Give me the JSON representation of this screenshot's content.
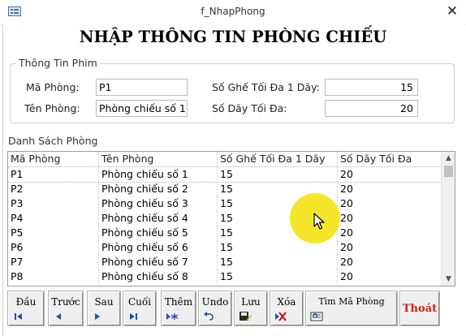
{
  "window": {
    "title": "f_NhapPhong"
  },
  "heading": "NHẬP THÔNG TIN PHÒNG CHIẾU",
  "info": {
    "caption": "Thông Tin Phim",
    "ma_phong_label": "Mã Phòng:",
    "ma_phong_value": "P1",
    "ten_phong_label": "Tên Phòng:",
    "ten_phong_value": "Phòng chiếu số 1",
    "so_ghe_label": "Số Ghế Tối Đa 1 Dãy:",
    "so_ghe_value": "15",
    "so_day_label": "Số Dãy Tối Đa:",
    "so_day_value": "20"
  },
  "list": {
    "caption": "Danh Sách Phòng",
    "headers": [
      "Mã Phòng",
      "Tên Phòng",
      "Số Ghế Tối Đa 1 Dãy",
      "Số Dãy Tối Đa"
    ],
    "rows": [
      [
        "P1",
        "Phòng chiếu số 1",
        "15",
        "20"
      ],
      [
        "P2",
        "Phòng chiếu số 2",
        "15",
        "20"
      ],
      [
        "P3",
        "Phòng chiếu số 3",
        "15",
        "20"
      ],
      [
        "P4",
        "Phòng chiếu số 4",
        "15",
        "20"
      ],
      [
        "P5",
        "Phòng chiếu số 5",
        "15",
        "20"
      ],
      [
        "P6",
        "Phòng chiếu số 6",
        "15",
        "20"
      ],
      [
        "P7",
        "Phòng chiếu số 7",
        "15",
        "20"
      ],
      [
        "P8",
        "Phòng chiếu số 8",
        "15",
        "20"
      ]
    ]
  },
  "buttons": {
    "first": "Đầu",
    "prev": "Trước",
    "next": "Sau",
    "last": "Cuối",
    "add": "Thêm",
    "undo": "Undo",
    "save": "Lưu",
    "delete": "Xóa",
    "find": "Tìm Mã Phòng",
    "exit": "Thoát"
  },
  "colors": {
    "exit_text": "#cc1f1f",
    "nav_icon": "#1f4fb3",
    "cursor_highlight": "#f4e41a"
  }
}
